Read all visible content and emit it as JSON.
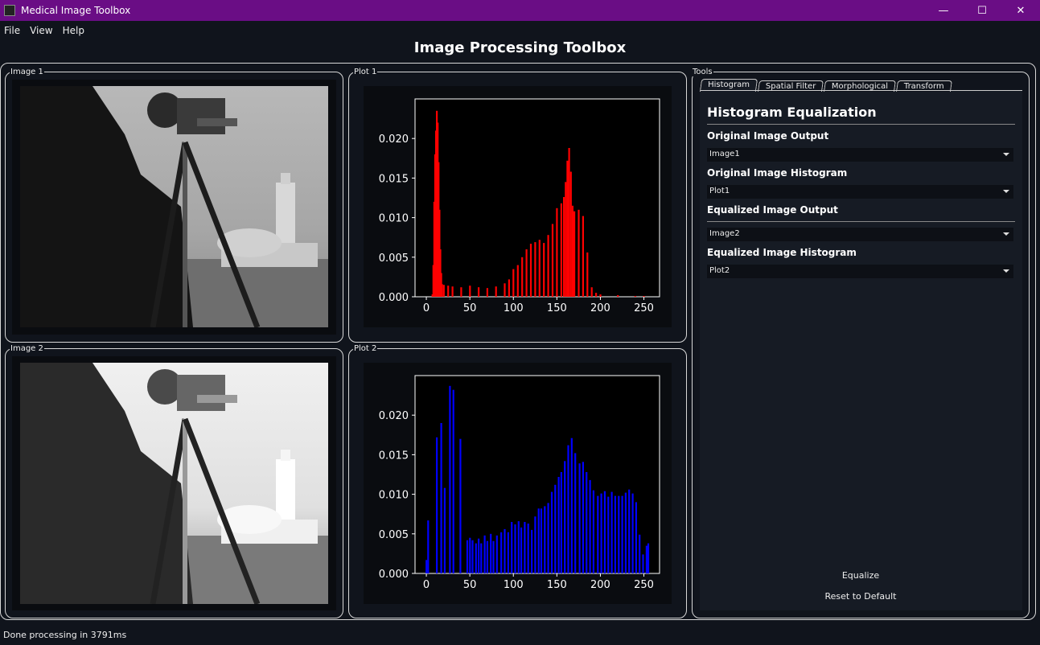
{
  "window": {
    "title": "Medical Image Toolbox",
    "controls": [
      "—",
      "☐",
      "✕"
    ]
  },
  "menu": [
    "File",
    "View",
    "Help"
  ],
  "page_title": "Image Processing Toolbox",
  "panels": {
    "image1": "Image 1",
    "plot1": "Plot 1",
    "image2": "Image 2",
    "plot2": "Plot 2",
    "tools": "Tools"
  },
  "tabs": [
    "Histogram",
    "Spatial Filter",
    "Morphological",
    "Transform"
  ],
  "active_tab": "Histogram",
  "tools": {
    "heading": "Histogram Equalization",
    "fields": [
      {
        "label": "Original Image Output",
        "value": "Image1"
      },
      {
        "label": "Original Image Histogram",
        "value": "Plot1"
      },
      {
        "label": "Equalized Image Output",
        "value": "Image2"
      },
      {
        "label": "Equalized Image Histogram",
        "value": "Plot2"
      }
    ],
    "equalize": "Equalize",
    "reset": "Reset to Default"
  },
  "status": "Done processing in 3791ms",
  "chart_data": [
    {
      "type": "bar",
      "color": "#ff0000",
      "xlim": [
        -13,
        268
      ],
      "ylim": [
        0,
        0.025
      ],
      "xticks": [
        0,
        50,
        100,
        150,
        200,
        250
      ],
      "yticks": [
        0.0,
        0.005,
        0.01,
        0.015,
        0.02
      ],
      "ytick_labels": [
        "0.000",
        "0.005",
        "0.010",
        "0.015",
        "0.020"
      ],
      "x": [
        7,
        8,
        9,
        10,
        11,
        12,
        13,
        14,
        15,
        16,
        17,
        18,
        20,
        25,
        30,
        40,
        50,
        60,
        70,
        80,
        90,
        95,
        100,
        105,
        110,
        115,
        120,
        125,
        130,
        135,
        140,
        145,
        150,
        155,
        158,
        160,
        162,
        164,
        166,
        168,
        170,
        175,
        180,
        185,
        190,
        195,
        200,
        220,
        240,
        250
      ],
      "values": [
        0.0003,
        0.004,
        0.012,
        0.018,
        0.021,
        0.0235,
        0.022,
        0.017,
        0.011,
        0.006,
        0.003,
        0.0016,
        0.0015,
        0.0014,
        0.0013,
        0.0012,
        0.0014,
        0.0012,
        0.0011,
        0.0013,
        0.0017,
        0.0022,
        0.0035,
        0.004,
        0.005,
        0.006,
        0.0067,
        0.0069,
        0.0072,
        0.0068,
        0.0078,
        0.0092,
        0.0112,
        0.0118,
        0.0126,
        0.0145,
        0.0172,
        0.0188,
        0.0158,
        0.0115,
        0.0108,
        0.011,
        0.0102,
        0.0056,
        0.0012,
        0.0005,
        0.0003,
        0.0002,
        0.0001,
        0.0001
      ]
    },
    {
      "type": "bar",
      "color": "#0000ff",
      "xlim": [
        -13,
        268
      ],
      "ylim": [
        0,
        0.025
      ],
      "xticks": [
        0,
        50,
        100,
        150,
        200,
        250
      ],
      "yticks": [
        0.0,
        0.005,
        0.01,
        0.015,
        0.02
      ],
      "ytick_labels": [
        "0.000",
        "0.005",
        "0.010",
        "0.015",
        "0.020"
      ],
      "x": [
        0,
        2,
        12,
        17,
        21,
        27,
        31,
        39,
        47,
        50,
        53,
        57,
        60,
        63,
        67,
        70,
        74,
        77,
        81,
        86,
        90,
        94,
        98,
        102,
        106,
        109,
        113,
        117,
        121,
        125,
        129,
        132,
        136,
        140,
        144,
        148,
        152,
        155,
        159,
        163,
        167,
        171,
        176,
        180,
        184,
        188,
        192,
        197,
        201,
        205,
        209,
        213,
        217,
        221,
        225,
        229,
        233,
        237,
        241,
        245,
        249,
        253,
        255
      ],
      "values": [
        0.0017,
        0.0067,
        0.0172,
        0.019,
        0.0108,
        0.0237,
        0.0232,
        0.017,
        0.0042,
        0.0045,
        0.0042,
        0.0038,
        0.0044,
        0.0038,
        0.0048,
        0.0041,
        0.005,
        0.0041,
        0.0048,
        0.0052,
        0.0056,
        0.0052,
        0.0065,
        0.0062,
        0.0066,
        0.0058,
        0.0065,
        0.0063,
        0.0055,
        0.0072,
        0.0082,
        0.0082,
        0.0085,
        0.0089,
        0.0103,
        0.0112,
        0.0122,
        0.0128,
        0.0142,
        0.0162,
        0.0171,
        0.0152,
        0.0139,
        0.0141,
        0.0128,
        0.0118,
        0.0105,
        0.0098,
        0.0101,
        0.0104,
        0.0097,
        0.0103,
        0.0098,
        0.0098,
        0.0098,
        0.0102,
        0.0106,
        0.0101,
        0.009,
        0.0049,
        0.0024,
        0.0035,
        0.0038
      ]
    }
  ]
}
